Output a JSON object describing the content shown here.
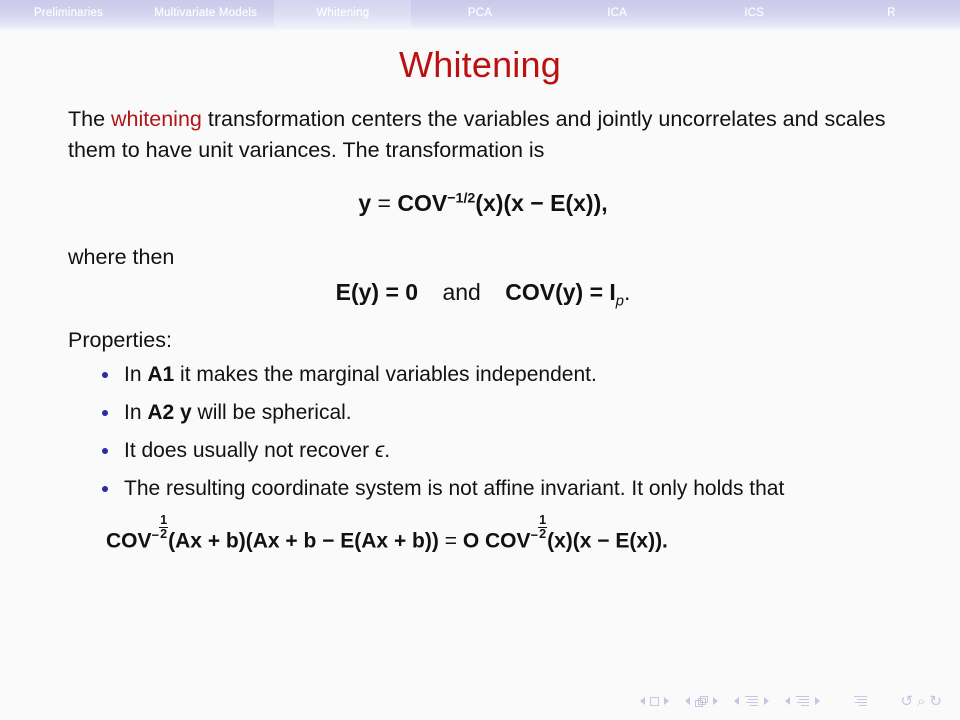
{
  "navbar": {
    "items": [
      {
        "label": "Preliminaries",
        "current": false
      },
      {
        "label": "Multivariate Models",
        "current": false
      },
      {
        "label": "Whitening",
        "current": true
      },
      {
        "label": "PCA",
        "current": false
      },
      {
        "label": "ICA",
        "current": false
      },
      {
        "label": "ICS",
        "current": false
      },
      {
        "label": "R",
        "current": false
      }
    ],
    "bar_color": "#d2d2ee",
    "label_color": "#ffffff"
  },
  "slide": {
    "title": "Whitening",
    "title_color": "#bb1111",
    "background": "#fafafa",
    "intro": {
      "before_keyword": "The ",
      "keyword": "whitening",
      "after_keyword": " transformation centers the variables and jointly uncorrelates and scales them to have unit variances. The transformation is"
    },
    "equation_1": {
      "lhs": "y",
      "relation": "=",
      "base": "COV",
      "exponent": "−1/2",
      "rest": "(x)(x − E(x)),",
      "plain": "y = COV^(−1/2)(x)(x − E(x)),"
    },
    "where_then": "where then",
    "equation_2": {
      "left": "E(y) = 0",
      "conjunction": "and",
      "right_base": "COV(y) = I",
      "right_sub": "p",
      "terminator": ".",
      "plain": "E(y) = 0  and  COV(y) = I_p."
    },
    "properties_heading": "Properties:",
    "properties": [
      {
        "prefix": "In ",
        "emphasis": "A1",
        "suffix": " it makes the marginal variables independent.",
        "plain": "In A1 it makes the marginal variables independent."
      },
      {
        "prefix": "In ",
        "emphasis": "A2 y",
        "suffix": " will be spherical.",
        "plain": "In A2 y will be spherical."
      },
      {
        "prefix": "It does usually not recover ",
        "emphasis": "ϵ",
        "suffix": ".",
        "plain": "It does usually not recover ϵ."
      },
      {
        "prefix": "The resulting coordinate system is not affine invariant. It only holds that",
        "emphasis": "",
        "suffix": "",
        "plain": "The resulting coordinate system is not affine invariant. It only holds that"
      }
    ],
    "equation_3": {
      "part_1_base": "COV",
      "part_1_exp_num": "1",
      "part_1_exp_den": "2",
      "part_1_rest": "(Ax + b)(Ax + b − E(Ax + b))",
      "relation": "=",
      "part_2_lead": "O COV",
      "part_2_rest": "(x)(x − E(x)).",
      "plain": "COV^(−1/2)(Ax + b)(Ax + b − E(Ax + b)) = O COV^(−1/2)(x)(x − E(x))."
    }
  },
  "footer_nav": {
    "icon_color": "#c6c6e2",
    "groups": [
      {
        "name": "first-frame-nav",
        "icon": "square-frame-icon"
      },
      {
        "name": "frame-nav",
        "icon": "stacked-frames-icon"
      },
      {
        "name": "subsection-nav",
        "icon": "lines-icon"
      },
      {
        "name": "section-nav",
        "icon": "lines-icon"
      }
    ],
    "standalone": [
      {
        "name": "document-icon",
        "icon": "lines-icon"
      },
      {
        "name": "back-icon",
        "glyph": "↺"
      },
      {
        "name": "search-icon",
        "glyph": "⌕"
      },
      {
        "name": "forward-icon",
        "glyph": "↻"
      }
    ]
  }
}
